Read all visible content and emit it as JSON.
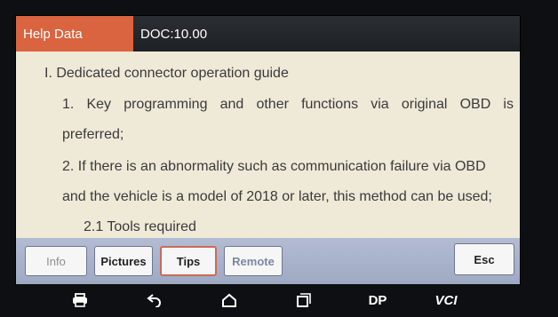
{
  "header": {
    "tab_label": "Help Data",
    "doc_code": "DOC:10.00",
    "tab_color": "#d9643f"
  },
  "content": {
    "heading": "I. Dedicated connector operation guide",
    "item1_words": [
      "1.",
      "Key",
      "programming",
      "and",
      "other",
      "functions",
      "via",
      "original",
      "OBD",
      "is"
    ],
    "item1_cont": "preferred;",
    "item2": "2. If there is an abnormality such as communication failure via OBD",
    "item2_cont": "and the vehicle is a model of 2018 or later, this method can be used;",
    "sub_heading": "2.1 Tools required"
  },
  "toolbar": {
    "info": "Info",
    "pictures": "Pictures",
    "tips": "Tips",
    "remote": "Remote",
    "esc": "Esc"
  },
  "navbar": {
    "icons": [
      "printer-icon",
      "back-icon",
      "home-icon",
      "recent-apps-icon"
    ],
    "dp": "DP",
    "vci": "VCI"
  }
}
